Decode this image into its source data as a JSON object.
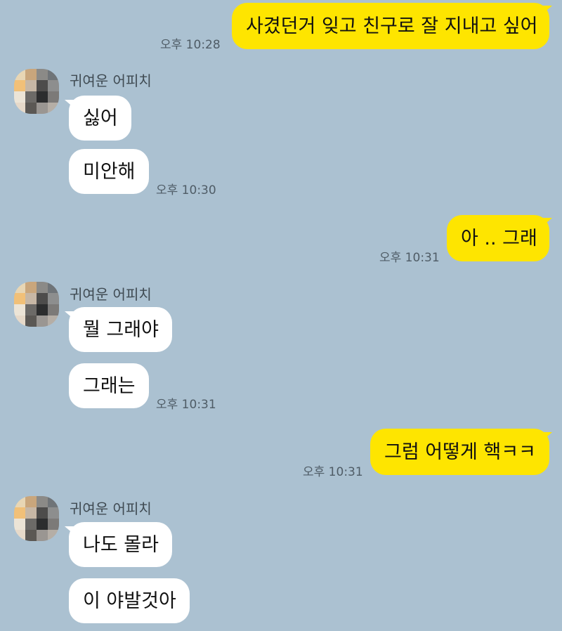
{
  "contact": {
    "name": "귀여운 어피치"
  },
  "colors": {
    "background": "#abc1d1",
    "my_bubble": "#fee500",
    "their_bubble": "#ffffff"
  },
  "messages": [
    {
      "sender": "me",
      "text": "사겼던거 잊고 친구로 잘 지내고 싶어",
      "time": "오후 10:28"
    },
    {
      "sender": "them",
      "text": "싫어",
      "time": ""
    },
    {
      "sender": "them",
      "text": "미안해",
      "time": "오후 10:30"
    },
    {
      "sender": "me",
      "text": "아 .. 그래",
      "time": "오후 10:31"
    },
    {
      "sender": "them",
      "text": "뭘 그래야",
      "time": ""
    },
    {
      "sender": "them",
      "text": "그래는",
      "time": "오후 10:31"
    },
    {
      "sender": "me",
      "text": "그럼 어떻게 핵ㅋㅋ",
      "time": "오후 10:31"
    },
    {
      "sender": "them",
      "text": "나도 몰라",
      "time": ""
    },
    {
      "sender": "them",
      "text": "이 야발것아",
      "time": ""
    }
  ]
}
